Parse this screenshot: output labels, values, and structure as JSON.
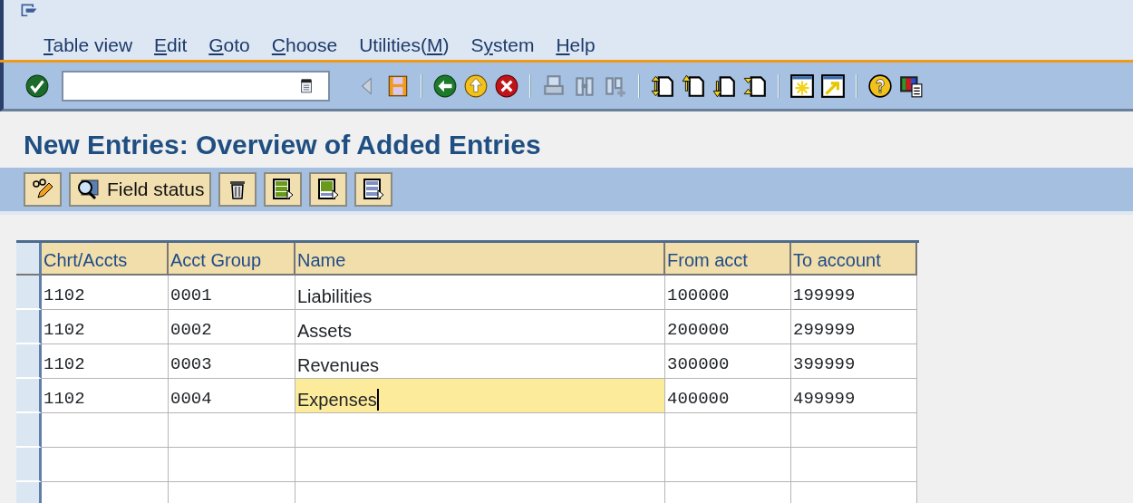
{
  "menu": [
    {
      "key": "T",
      "post": "able view"
    },
    {
      "key": "E",
      "post": "dit"
    },
    {
      "key": "G",
      "post": "oto"
    },
    {
      "key": "C",
      "post": "hoose"
    },
    {
      "pre": "Utilities(",
      "key": "M",
      "post": ")"
    },
    {
      "pre": "S",
      "key": "y",
      "post": "stem"
    },
    {
      "key": "H",
      "post": "elp"
    }
  ],
  "toolbar": [
    {
      "kind": "enter",
      "disabled": false
    },
    {
      "kind": "command-field"
    },
    {
      "kind": "back-small",
      "disabled": false
    },
    {
      "kind": "save",
      "disabled": false
    },
    {
      "kind": "sep"
    },
    {
      "kind": "back",
      "disabled": false
    },
    {
      "kind": "exit",
      "disabled": false
    },
    {
      "kind": "cancel",
      "disabled": false
    },
    {
      "kind": "sep"
    },
    {
      "kind": "print",
      "disabled": true
    },
    {
      "kind": "find",
      "disabled": true
    },
    {
      "kind": "find-next",
      "disabled": true
    },
    {
      "kind": "sep"
    },
    {
      "kind": "page-first",
      "disabled": false
    },
    {
      "kind": "page-up",
      "disabled": false
    },
    {
      "kind": "page-down",
      "disabled": false
    },
    {
      "kind": "page-last",
      "disabled": false
    },
    {
      "kind": "sep"
    },
    {
      "kind": "new-session",
      "disabled": false
    },
    {
      "kind": "shortcut",
      "disabled": false
    },
    {
      "kind": "sep"
    },
    {
      "kind": "help",
      "disabled": false
    },
    {
      "kind": "layout",
      "disabled": false
    }
  ],
  "title": "New Entries: Overview of Added Entries",
  "app_toolbar": [
    {
      "kind": "edit"
    },
    {
      "kind": "field-status",
      "label": "Field status"
    },
    {
      "kind": "delete"
    },
    {
      "kind": "select-all"
    },
    {
      "kind": "select-block"
    },
    {
      "kind": "deselect-all"
    }
  ],
  "table": {
    "columns": [
      "Chrt/Accts",
      "Acct Group",
      "Name",
      "From acct",
      "To account"
    ],
    "rows": [
      {
        "cells": [
          {
            "text": "1102",
            "focused": false
          },
          {
            "text": "0001",
            "focused": false
          },
          {
            "text": "Liabilities",
            "focused": false
          },
          {
            "text": "100000",
            "focused": false
          },
          {
            "text": "199999",
            "focused": false
          }
        ]
      },
      {
        "cells": [
          {
            "text": "1102",
            "focused": false
          },
          {
            "text": "0002",
            "focused": false
          },
          {
            "text": "Assets",
            "focused": false
          },
          {
            "text": "200000",
            "focused": false
          },
          {
            "text": "299999",
            "focused": false
          }
        ]
      },
      {
        "cells": [
          {
            "text": "1102",
            "focused": false
          },
          {
            "text": "0003",
            "focused": false
          },
          {
            "text": "Revenues",
            "focused": false
          },
          {
            "text": "300000",
            "focused": false
          },
          {
            "text": "399999",
            "focused": false
          }
        ]
      },
      {
        "cells": [
          {
            "text": "1102",
            "focused": false
          },
          {
            "text": "0004",
            "focused": false
          },
          {
            "text": "Expenses",
            "focused": true
          },
          {
            "text": "400000",
            "focused": false
          },
          {
            "text": "499999",
            "focused": false
          }
        ]
      }
    ]
  }
}
